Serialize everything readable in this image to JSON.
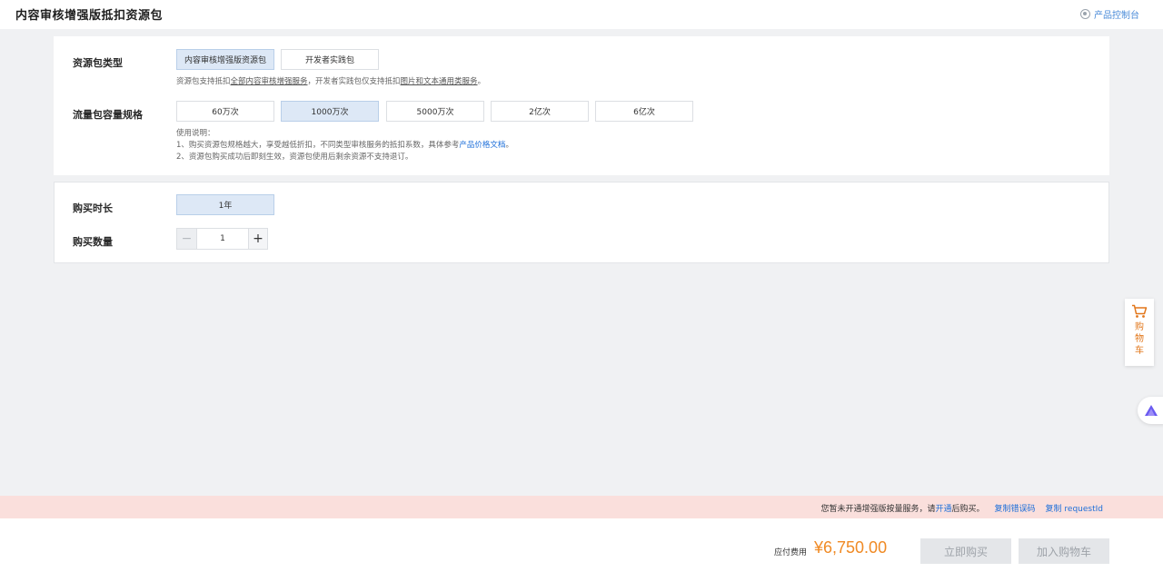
{
  "header": {
    "title": "内容审核增强版抵扣资源包",
    "console_link": "产品控制台"
  },
  "package_type": {
    "label": "资源包类型",
    "options": [
      "内容审核增强版资源包",
      "开发者实践包"
    ],
    "selected": "内容审核增强版资源包",
    "note_prefix": "资源包支持抵扣",
    "note_link1": "全部内容审核增强服务",
    "note_middle": "，开发者实践包仅支持抵扣",
    "note_link2": "图片和文本通用类服务",
    "note_suffix": "。"
  },
  "capacity": {
    "label": "流量包容量规格",
    "options": [
      "60万次",
      "1000万次",
      "5000万次",
      "2亿次",
      "6亿次"
    ],
    "selected": "1000万次",
    "notes_title": "使用说明：",
    "note1_text": "1、购买资源包规格越大，享受越低折扣，不同类型审核服务的抵扣系数，具体参考",
    "note1_link": "产品价格文档",
    "note1_end": "。",
    "note2_text": "2、资源包购买成功后即刻生效，资源包使用后剩余资源不支持退订。"
  },
  "duration": {
    "label": "购买时长",
    "options": [
      "1年"
    ],
    "selected": "1年"
  },
  "quantity": {
    "label": "购买数量",
    "value": "1",
    "minus": "−",
    "plus": "+"
  },
  "cart_float": {
    "label": "购物车",
    "icon": "cart-icon"
  },
  "assistant_float": {
    "icon": "assistant-icon"
  },
  "alert": {
    "text_before": "您暂未开通增强版按量服务，请",
    "link": "开通",
    "text_after": "后购买。",
    "action1": "复制错误码",
    "action2": "复制 requestId"
  },
  "footer": {
    "fee_label": "应付费用",
    "fee_amount": "¥6,750.00",
    "buy_button": "立即购买",
    "add_cart_button": "加入购物车"
  },
  "colors": {
    "accent": "#1e6fd9",
    "price": "#f08a24",
    "selected_bg": "#dde8f6",
    "alert_bg": "#fadfdc"
  }
}
